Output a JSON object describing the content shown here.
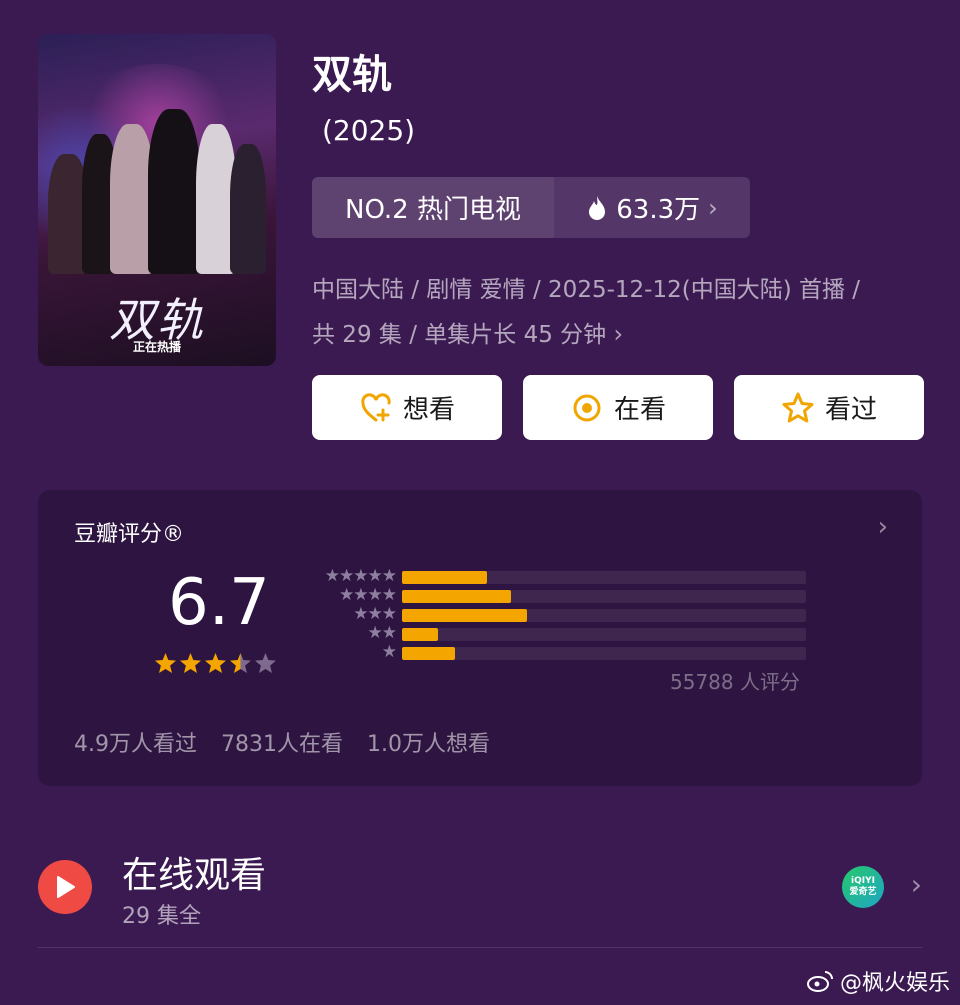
{
  "poster": {
    "title": "双轨",
    "subtitle": "正在热播"
  },
  "show": {
    "title": "双轨",
    "year": "(2025)"
  },
  "rank": {
    "label": "NO.2 热门电视",
    "heat": "63.3万"
  },
  "meta": {
    "line1": "中国大陆 / 剧情 爱情 / 2025-12-12(中国大陆) 首播 /",
    "line2": "共 29 集 / 单集片长 45 分钟"
  },
  "actions": {
    "want": "想看",
    "watching": "在看",
    "watched": "看过"
  },
  "rating": {
    "label": "豆瓣评分®",
    "score": "6.7",
    "stars": 3.5,
    "count_label": "55788 人评分",
    "distribution": [
      {
        "stars": 5,
        "fraction": 0.21
      },
      {
        "stars": 4,
        "fraction": 0.27
      },
      {
        "stars": 3,
        "fraction": 0.31
      },
      {
        "stars": 2,
        "fraction": 0.09
      },
      {
        "stars": 1,
        "fraction": 0.13
      }
    ],
    "watched": "4.9万人看过",
    "watching": "7831人在看",
    "want": "1.0万人想看"
  },
  "online": {
    "title": "在线观看",
    "episodes": "29 集全",
    "provider_line1": "iQIYI",
    "provider_line2": "爱奇艺"
  },
  "watermark": "@枫火娱乐",
  "colors": {
    "background": "#3b1a52",
    "accent": "#f5a500",
    "play": "#ef4b44"
  }
}
